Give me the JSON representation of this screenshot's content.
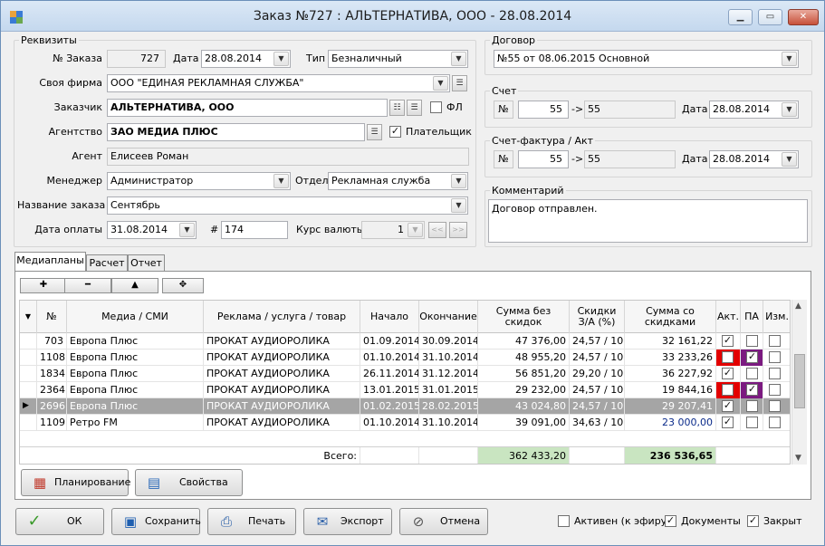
{
  "window": {
    "title": "Заказ №727 : АЛЬТЕРНАТИВА, ООО - 28.08.2014",
    "min": "▭",
    "max": "▭",
    "close": "✕"
  },
  "requisites": {
    "group_label": "Реквизиты",
    "order_no_label": "№ Заказа",
    "order_no": "727",
    "date_label": "Дата",
    "date": "28.08.2014",
    "type_label": "Тип",
    "type": "Безналичный",
    "own_firm_label": "Своя фирма",
    "own_firm": "ООО \"ЕДИНАЯ РЕКЛАМНАЯ СЛУЖБА\"",
    "customer_label": "Заказчик",
    "customer": "АЛЬТЕРНАТИВА, ООО",
    "fl_label": "ФЛ",
    "agency_label": "Агентство",
    "agency": "ЗАО МЕДИА ПЛЮС",
    "payer_label": "Плательщик",
    "agent_label": "Агент",
    "agent": "Елисеев Роман",
    "manager_label": "Менеджер",
    "manager": "Администратор",
    "dept_label": "Отдел",
    "dept": "Рекламная служба",
    "order_name_label": "Название заказа",
    "order_name": "Сентябрь",
    "pay_date_label": "Дата оплаты",
    "pay_date": "31.08.2014",
    "hash_label": "#",
    "hash": "174",
    "rate_label": "Курс валюты",
    "rate": "1",
    "prev": "<<",
    "next": ">>"
  },
  "contract": {
    "group_label": "Договор",
    "value": "№55 от 08.06.2015 Основной"
  },
  "invoice": {
    "group_label": "Счет",
    "no_label": "№",
    "no": "55",
    "arrow": "->",
    "no2": "55",
    "date_label": "Дата",
    "date": "28.08.2014"
  },
  "act": {
    "group_label": "Счет-фактура / Акт",
    "no_label": "№",
    "no": "55",
    "arrow": "->",
    "no2": "55",
    "date_label": "Дата",
    "date": "28.08.2014"
  },
  "comment": {
    "group_label": "Комментарий",
    "text": "Договор отправлен."
  },
  "tabs": [
    {
      "label": "Медиапланы"
    },
    {
      "label": "Расчет"
    },
    {
      "label": "Отчет"
    }
  ],
  "toolbar": {
    "add": "✚",
    "remove": "━",
    "up": "▲",
    "tool": "✥"
  },
  "grid": {
    "headers": {
      "num": "№",
      "media": "Медиа / СМИ",
      "ad": "Реклама / услуга / товар",
      "start": "Начало",
      "end": "Окончание",
      "sum": "Сумма без скидок",
      "disc": "Скидки З/А (%)",
      "sumd": "Сумма со скидками",
      "act": "Акт.",
      "pa": "ПА",
      "chg": "Изм."
    },
    "rows": [
      {
        "num": "703",
        "media": "Европа Плюс",
        "ad": "ПРОКАТ АУДИОРОЛИКА",
        "start": "01.09.2014",
        "end": "30.09.2014",
        "sum": "47 376,00",
        "disc": "24,57 / 10",
        "sumd": "32 161,22",
        "act": true,
        "pa": false,
        "chg": false
      },
      {
        "num": "1108",
        "media": "Европа Плюс",
        "ad": "ПРОКАТ АУДИОРОЛИКА",
        "start": "01.10.2014",
        "end": "31.10.2014",
        "sum": "48 955,20",
        "disc": "24,57 / 10",
        "sumd": "33 233,26",
        "act": false,
        "pa": true,
        "chg": false
      },
      {
        "num": "1834",
        "media": "Европа Плюс",
        "ad": "ПРОКАТ АУДИОРОЛИКА",
        "start": "26.11.2014",
        "end": "31.12.2014",
        "sum": "56 851,20",
        "disc": "29,20 / 10",
        "sumd": "36 227,92",
        "act": true,
        "pa": false,
        "chg": false
      },
      {
        "num": "2364",
        "media": "Европа Плюс",
        "ad": "ПРОКАТ АУДИОРОЛИКА",
        "start": "13.01.2015",
        "end": "31.01.2015",
        "sum": "29 232,00",
        "disc": "24,57 / 10",
        "sumd": "19 844,16",
        "act": false,
        "pa": true,
        "chg": false
      },
      {
        "num": "2696",
        "media": "Европа Плюс",
        "ad": "ПРОКАТ АУДИОРОЛИКА",
        "start": "01.02.2015",
        "end": "28.02.2015",
        "sum": "43 024,80",
        "disc": "24,57 / 10",
        "sumd": "29 207,41",
        "act": true,
        "pa": false,
        "chg": false
      },
      {
        "num": "1109",
        "media": "Ретро FM",
        "ad": "ПРОКАТ АУДИОРОЛИКА",
        "start": "01.10.2014",
        "end": "31.10.2014",
        "sum": "39 091,00",
        "disc": "34,63 / 10",
        "sumd": "23 000,00",
        "act": true,
        "pa": false,
        "chg": false
      }
    ],
    "total_label": "Всего:",
    "total_sum": "362 433,20",
    "total_sumd": "236 536,65"
  },
  "panel_buttons": {
    "planning": "Планирование",
    "props": "Свойства"
  },
  "bottom": {
    "ok": "ОК",
    "save": "Сохранить",
    "print": "Печать",
    "export": "Экспорт",
    "cancel": "Отмена",
    "active_label": "Активен (к эфиру)",
    "docs_label": "Документы",
    "closed_label": "Закрыт"
  },
  "colors": {
    "act_flag": "#e30000",
    "pa_flag": "#7b1a80",
    "total_bg": "#c9e5c1",
    "selected_row": "#a5a5a5",
    "link_blue": "#0a2a8a"
  }
}
